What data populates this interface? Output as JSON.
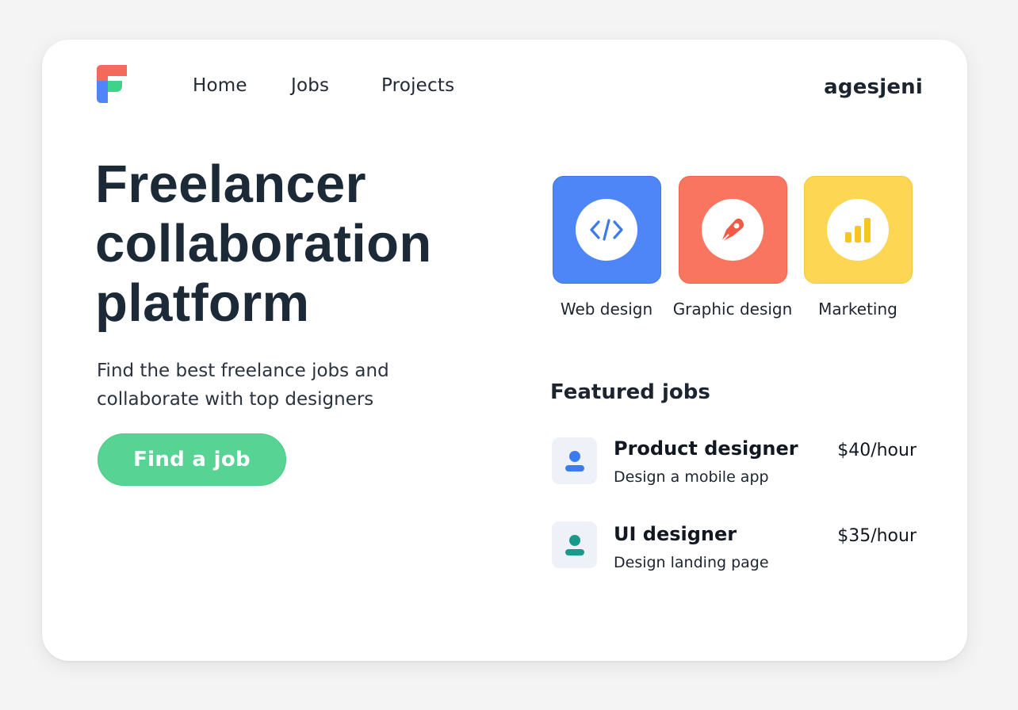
{
  "nav": {
    "items": [
      {
        "label": "Home"
      },
      {
        "label": "Jobs"
      },
      {
        "label": "Projects"
      }
    ],
    "brand": "agesjeni"
  },
  "hero": {
    "title_lines": [
      "Freelancer",
      "collaboration",
      "platform"
    ],
    "subtitle": "Find the best freelance jobs and collaborate with top designers",
    "cta_label": "Find a job"
  },
  "categories": [
    {
      "label": "Web design",
      "icon": "code-icon",
      "color": "#4f86f7"
    },
    {
      "label": "Graphic design",
      "icon": "pen-tool-icon",
      "color": "#fa7560"
    },
    {
      "label": "Marketing",
      "icon": "bar-chart-icon",
      "color": "#fdd653"
    }
  ],
  "featured": {
    "title": "Featured jobs",
    "jobs": [
      {
        "title": "Product designer",
        "description": "Design a mobile app",
        "rate": "$40/hour",
        "icon": "person-icon",
        "icon_color": "#3b7bf0"
      },
      {
        "title": "UI designer",
        "description": "Design landing page",
        "rate": "$35/hour",
        "icon": "person-icon",
        "icon_color": "#179a8a"
      }
    ]
  },
  "colors": {
    "accent_green": "#57d394",
    "text_dark": "#1c2a38",
    "logo_red": "#f26a5b",
    "logo_blue": "#4f86f7",
    "logo_green": "#3fd38a"
  }
}
